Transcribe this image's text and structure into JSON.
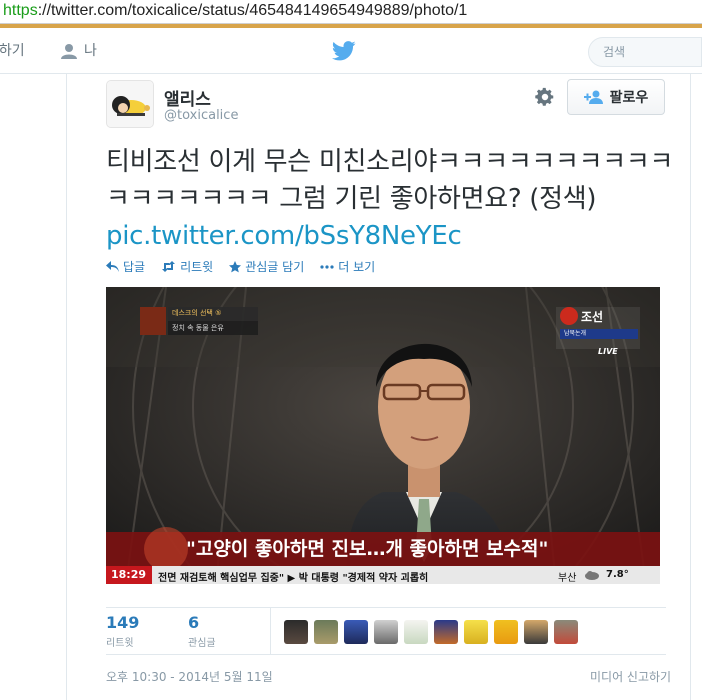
{
  "browser": {
    "url_protocol": "https",
    "url_rest": "://twitter.com/toxicalice/status/465484149654949889/photo/1"
  },
  "nav": {
    "home_label": "홈하기",
    "me_label": "나",
    "search_placeholder": "검색"
  },
  "tweet": {
    "display_name": "앨리스",
    "handle": "@toxicalice",
    "follow_label": "팔로우",
    "text": "티비조선 이게 무슨 미친소리야ㅋㅋㅋㅋㅋㅋㅋㅋㅋㅋㅋㅋㅋㅋㅋㅋㅋ 그럼 기린 좋아하면요? (정색) ",
    "link": "pic.twitter.com/bSsY8NeYEc",
    "actions": {
      "reply": "답글",
      "retweet": "리트윗",
      "favorite": "관심글 담기",
      "more": "더 보기"
    },
    "timestamp": "오후 10:30 - 2014년 5월 11일",
    "report_label": "미디어 신고하기"
  },
  "media": {
    "headline": "\"고양이 좋아하면 진보…개 좋아하면 보수적\"",
    "top_tag": "데스크의 선택 ⑤",
    "top_tag_sub": "정치 속 동물 은유",
    "channel": "조선",
    "channel_sub": "남북논개",
    "live_label": "LIVE",
    "ticker_time": "18:29",
    "ticker_text": "전면 재검토해 핵심업무 집중\"  ▶ 박 대통령 \"경제적 약자 괴롭히",
    "ticker_weather": "부산",
    "ticker_temp": "7.8°"
  },
  "stats": {
    "retweets": "149",
    "retweets_label": "리트윗",
    "favorites": "6",
    "favorites_label": "관심글"
  },
  "colors": {
    "link": "#1b95c6",
    "action": "#2b7bb9",
    "accent": "#d8a44a",
    "ticker_red": "#c6171d"
  }
}
